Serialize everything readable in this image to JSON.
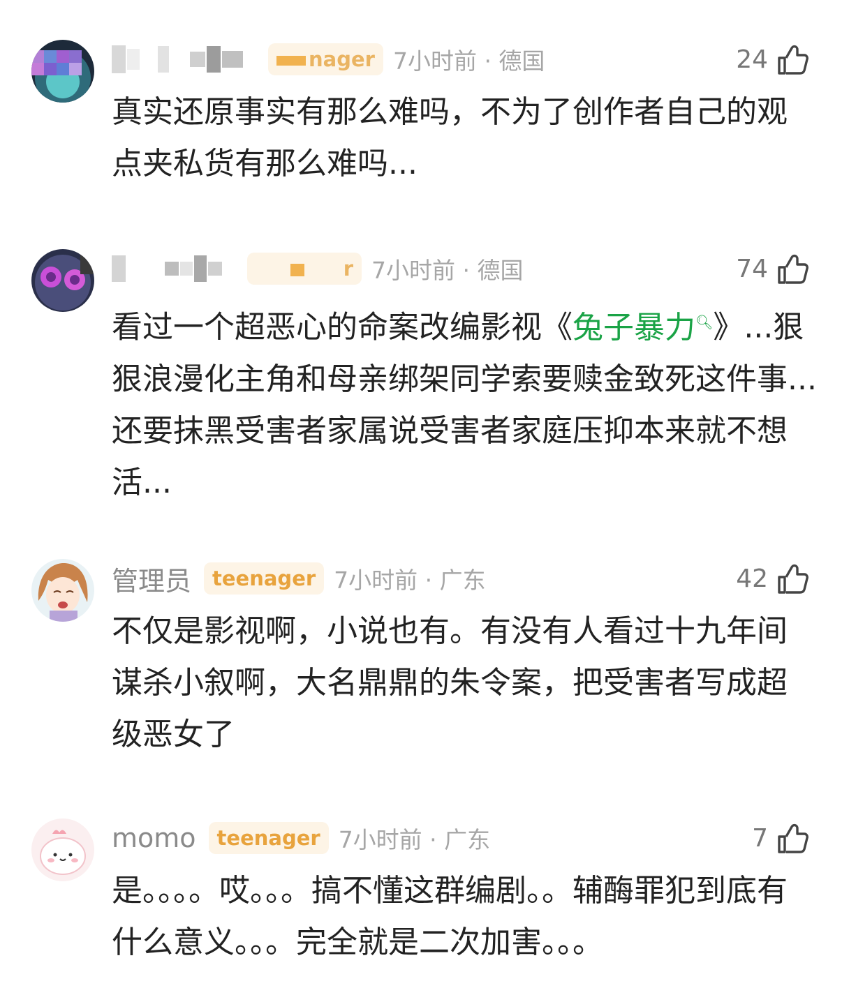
{
  "comments": [
    {
      "username": "",
      "badge": "nager",
      "time_location": "7小时前 · 德国",
      "likes": "24",
      "text": "真实还原事实有那么难吗，不为了创作者自己的观点夹私货有那么难吗..."
    },
    {
      "username": "",
      "badge": "r",
      "time_location": "7小时前 · 德国",
      "likes": "74",
      "text_before": "看过一个超恶心的命案改编影视《",
      "link_text": "兔子暴力",
      "text_after": "》...狠狠浪漫化主角和母亲绑架同学索要赎金致死这件事...还要抹黑受害者家属说受害者家庭压抑本来就不想活..."
    },
    {
      "username": "管理员",
      "badge": "teenager",
      "time_location": "7小时前 · 广东",
      "likes": "42",
      "text": "不仅是影视啊，小说也有。有没有人看过十九年间谋杀小叙啊，大名鼎鼎的朱令案，把受害者写成超级恶女了"
    },
    {
      "username": "momo",
      "badge": "teenager",
      "time_location": "7小时前 · 广东",
      "likes": "7",
      "text": "是。。。。哎。。。搞不懂这群编剧。。辅酶罪犯到底有什么意义。。。完全就是二次加害。。。"
    }
  ],
  "icons": {
    "like": "thumbs-up-icon",
    "search": "search-icon"
  },
  "colors": {
    "badge_text": "#e8a33d",
    "badge_bg": "#fdf4e6",
    "link": "#1aa346",
    "meta_gray": "#a6a6a6"
  }
}
